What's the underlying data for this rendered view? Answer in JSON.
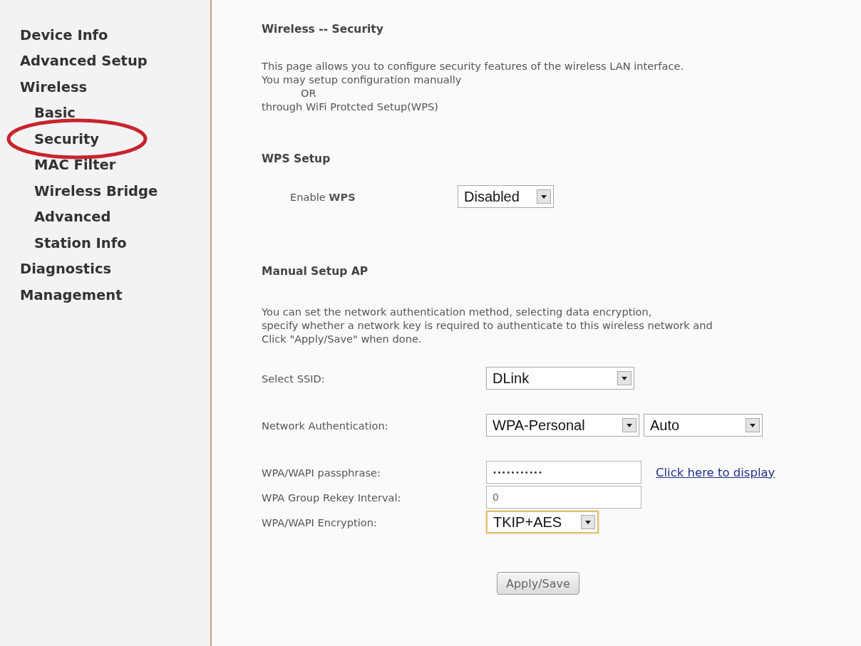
{
  "sidebar": {
    "items": [
      {
        "label": "Device Info",
        "circled": false
      },
      {
        "label": "Advanced Setup",
        "circled": false
      },
      {
        "label": "Wireless",
        "circled": false,
        "children": [
          {
            "label": "Basic",
            "circled": false
          },
          {
            "label": "Security",
            "circled": true
          },
          {
            "label": "MAC Filter",
            "circled": false
          },
          {
            "label": "Wireless Bridge",
            "circled": false
          },
          {
            "label": "Advanced",
            "circled": false
          },
          {
            "label": "Station Info",
            "circled": false
          }
        ]
      },
      {
        "label": "Diagnostics",
        "circled": false
      },
      {
        "label": "Management",
        "circled": false
      }
    ]
  },
  "page": {
    "title": "Wireless -- Security",
    "intro": [
      "This page allows you to configure security features of the wireless LAN interface.",
      "You may setup configuration manually",
      "OR",
      "through WiFi Protcted Setup(WPS)"
    ]
  },
  "wps": {
    "title": "WPS Setup",
    "enable_label": "Enable **WPS**",
    "select": {
      "value": "Disabled",
      "focused": false
    }
  },
  "manual": {
    "title": "Manual Setup AP",
    "description": [
      "You can set the network authentication method, selecting data encryption,",
      "specify whether a network key is required to authenticate to this wireless network and",
      "Click \"Apply/Save\" when done."
    ],
    "fields": [
      {
        "kind": "select",
        "label": "Select SSID:",
        "controls": [
          {
            "value": "DLink",
            "focused": false
          }
        ]
      },
      {
        "kind": "select",
        "label": "Network Authentication:",
        "controls": [
          {
            "value": "WPA-Personal",
            "focused": false
          },
          {
            "value": "Auto",
            "focused": false
          }
        ]
      },
      {
        "kind": "password",
        "label": "WPA/WAPI passphrase:",
        "value": "•••••••••••",
        "link": "Click here to display"
      },
      {
        "kind": "text",
        "label": "WPA Group Rekey Interval:",
        "value": "0"
      },
      {
        "kind": "select",
        "label": "WPA/WAPI Encryption:",
        "controls": [
          {
            "value": "TKIP+AES",
            "focused": true
          }
        ]
      }
    ],
    "button": "Apply/Save"
  }
}
